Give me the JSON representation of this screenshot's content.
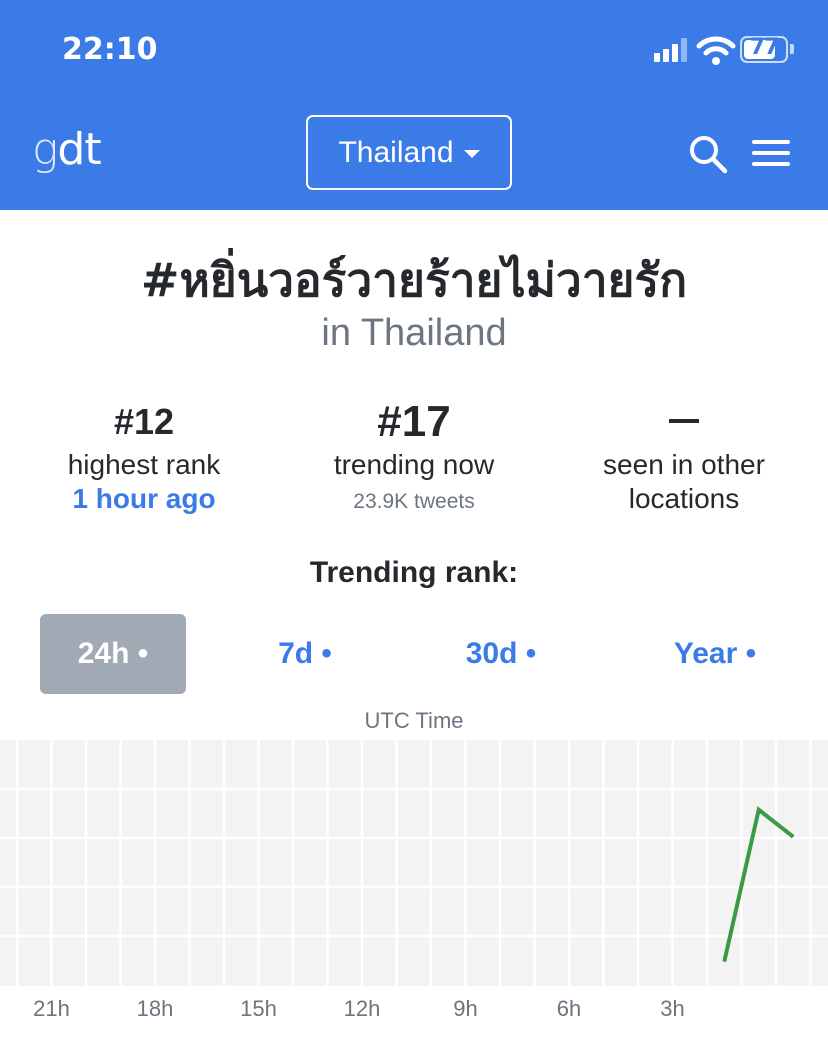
{
  "status_bar": {
    "time": "22:10",
    "battery": "77",
    "battery_level": 0.77,
    "icons": [
      "signal-icon",
      "wifi-icon",
      "battery-icon"
    ]
  },
  "header": {
    "logo": {
      "g": "g",
      "dt": "dt"
    },
    "country": "Thailand",
    "icons": [
      "search-icon",
      "menu-icon"
    ]
  },
  "hashtag": {
    "title": "#หยิ่นวอร์วายร้ายไม่วายรัก",
    "subtitle": "in Thailand"
  },
  "stats": {
    "highest": {
      "value": "#12",
      "label": "highest rank",
      "time": "1 hour ago"
    },
    "current": {
      "value": "#17",
      "label": "trending now",
      "tweets": "23.9K tweets"
    },
    "other": {
      "value": "—",
      "label_line1": "seen in other",
      "label_line2": "locations"
    }
  },
  "rank_section": {
    "label": "Trending rank:",
    "tabs": [
      {
        "label": "24h •",
        "active": true
      },
      {
        "label": "7d •",
        "active": false
      },
      {
        "label": "30d •",
        "active": false
      },
      {
        "label": "Year •",
        "active": false
      }
    ],
    "axis_title": "UTC Time"
  },
  "colors": {
    "brand": "#3a7be8",
    "line": "#3a9a45",
    "tab_active": "#a0a9b4",
    "grid_bg": "#f3f3f3"
  },
  "chart_data": {
    "type": "line",
    "xlabel": "UTC Time",
    "ticks": [
      "21h",
      "18h",
      "15h",
      "12h",
      "9h",
      "6h",
      "3h"
    ],
    "grid": true,
    "series": [
      {
        "x_hours_ago": [
          1.5,
          0.5,
          -0.5
        ],
        "rank": [
          40,
          12,
          17
        ]
      }
    ],
    "x_range_hours_ago": [
      24,
      -0.5
    ],
    "y_range_rank": [
      1,
      50
    ]
  }
}
